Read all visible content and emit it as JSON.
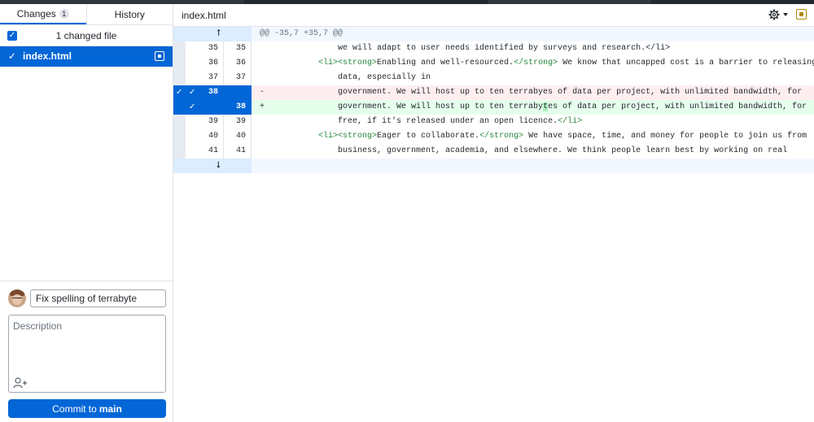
{
  "sidebar": {
    "tabs": [
      {
        "label": "Changes",
        "badge": "1"
      },
      {
        "label": "History"
      }
    ],
    "changed_files_label": "1 changed file",
    "files": [
      {
        "name": "index.html"
      }
    ]
  },
  "commit": {
    "summary_value": "Fix spelling of terrabyte",
    "description_placeholder": "Description",
    "button_prefix": "Commit to",
    "button_branch": "main"
  },
  "diff": {
    "file_path": "index.html",
    "hunk_header": "@@ -35,7 +35,7 @@",
    "lines": [
      {
        "old": "35",
        "new": "35",
        "type": "context",
        "text": "                we will adapt to user needs identified by surveys and research.</li>"
      },
      {
        "old": "36",
        "new": "36",
        "type": "context",
        "text": "            <li><strong>Enabling and well-resourced.</strong> We know that uncapped cost is a barrier to releasing"
      },
      {
        "old": "37",
        "new": "37",
        "type": "context",
        "text": "                data, especially in"
      },
      {
        "old": "38",
        "new": "",
        "type": "del",
        "marker": "-",
        "text": "                government. We will host up to ten terrabyes of data per project, with unlimited bandwidth, for"
      },
      {
        "old": "",
        "new": "38",
        "type": "add",
        "marker": "+",
        "text_before": "                government. We will host up to ten terraby",
        "text_hl": "t",
        "text_after": "es of data per project, with unlimited bandwidth, for"
      },
      {
        "old": "39",
        "new": "39",
        "type": "context",
        "text": "                free, if it's released under an open licence.</li>"
      },
      {
        "old": "40",
        "new": "40",
        "type": "context",
        "text": "            <li><strong>Eager to collaborate.</strong> We have space, time, and money for people to join us from"
      },
      {
        "old": "41",
        "new": "41",
        "type": "context",
        "text": "                business, government, academia, and elsewhere. We think people learn best by working on real"
      }
    ]
  },
  "icons": {
    "expand_up": "expand-up-icon",
    "expand_down": "expand-down-icon",
    "gear": "gear-icon",
    "modified": "file-modified-icon",
    "coauthor": "add-coauthor-icon"
  },
  "colors": {
    "accent": "#0366d6",
    "deleted_bg": "#ffeef0",
    "added_bg": "#e6ffed",
    "hunk_bg": "#f1f8ff"
  }
}
